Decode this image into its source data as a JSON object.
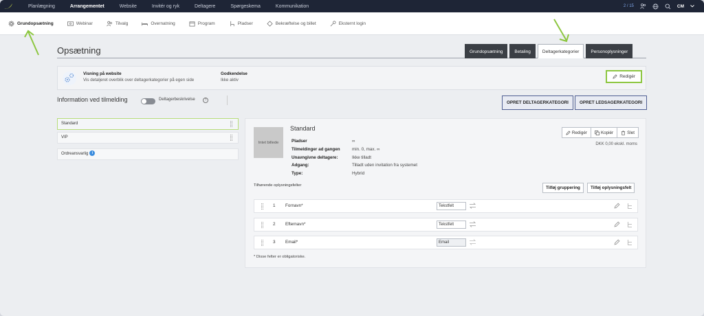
{
  "topnav": {
    "items": [
      "Planlægning",
      "Arrangementet",
      "Website",
      "Invitér og ryk",
      "Deltagere",
      "Spørgeskema",
      "Kommunikation"
    ],
    "active_index": 1,
    "count": "2 / 15",
    "user_initials": "CM"
  },
  "subnav": {
    "items": [
      {
        "label": "Grundopsætning",
        "icon": "gear-icon"
      },
      {
        "label": "Webinar",
        "icon": "video-icon"
      },
      {
        "label": "Tilvalg",
        "icon": "people-icon"
      },
      {
        "label": "Overnatning",
        "icon": "bed-icon"
      },
      {
        "label": "Program",
        "icon": "calendar-icon"
      },
      {
        "label": "Pladser",
        "icon": "chair-icon"
      },
      {
        "label": "Bekræftelse og billet",
        "icon": "ticket-icon"
      },
      {
        "label": "Eksternt login",
        "icon": "key-icon"
      }
    ],
    "active_index": 0
  },
  "page": {
    "title": "Opsætning",
    "tabs": [
      "Grundopsætning",
      "Betaling",
      "Deltagerkategorier",
      "Personoplysninger"
    ],
    "active_tab": 2
  },
  "info_panel": {
    "website_heading": "Visning på website",
    "website_text": "Vis detaljeret overblik over deltagerkategorier på egen side",
    "approval_heading": "Godkendelse",
    "approval_text": "Ikke aktiv",
    "edit_label": "Redigér"
  },
  "registration": {
    "title": "Information ved tilmelding",
    "toggle_label": "Deltagerbeskrivelse",
    "help": "?",
    "btn_create_category": "OPRET DELTAGERKATEGORI",
    "btn_create_companion": "OPRET LEDSAGERKATEGORI"
  },
  "categories": [
    {
      "label": "Standard",
      "selected": true,
      "draggable": true
    },
    {
      "label": "VIP",
      "selected": false,
      "draggable": true
    },
    {
      "label": "Ordreansvarlig",
      "selected": false,
      "draggable": false,
      "info": "i"
    }
  ],
  "detail": {
    "image_placeholder": "Intet billede",
    "name": "Standard",
    "props": [
      {
        "k": "Pladser",
        "v": "∞"
      },
      {
        "k": "Tilmeldinger ad gangen",
        "v": "min. 0, max. ∞"
      },
      {
        "k": "Unavngivne deltagere:",
        "v": "Ikke tilladt"
      },
      {
        "k": "Adgang:",
        "v": "Tilladt uden invitation fra systemet"
      },
      {
        "k": "Type:",
        "v": "Hybrid"
      }
    ],
    "actions": {
      "edit": "Redigér",
      "copy": "Kopiér",
      "delete": "Slet"
    },
    "price": "DKK 0,00 ekskl. moms",
    "fields_label": "Tilhørende oplysningsfelter",
    "btn_add_group": "Tilføj gruppering",
    "btn_add_field": "Tilføj oplysningsfelt",
    "fields": [
      {
        "num": "1",
        "name": "Fornavn*",
        "type": "Tekstfelt"
      },
      {
        "num": "2",
        "name": "Efternavn*",
        "type": "Tekstfelt"
      },
      {
        "num": "3",
        "name": "Email*",
        "type": "Email"
      }
    ],
    "footnote": "* Disse felter er obligatoriske."
  },
  "colors": {
    "topnav_bg": "#1e2536",
    "highlight_green": "#8cc63f",
    "tab_dark": "#3b3f45",
    "button_border": "#4f5e92"
  }
}
